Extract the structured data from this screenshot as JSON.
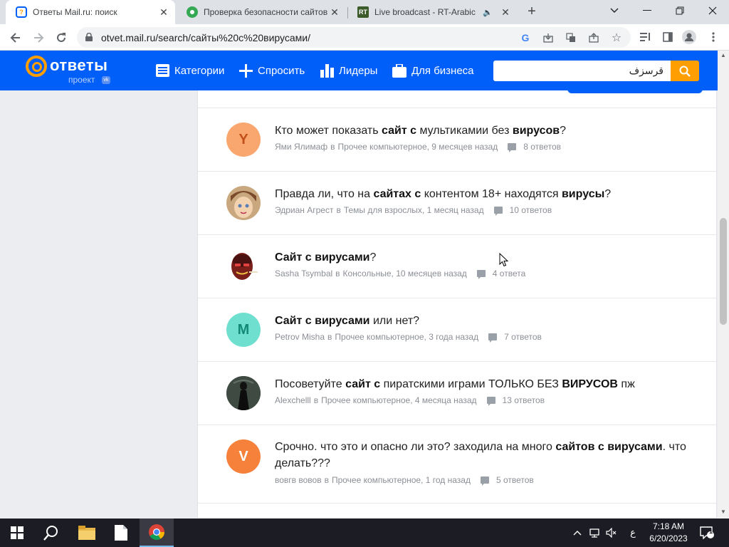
{
  "browser": {
    "tabs": [
      {
        "title": "Ответы Mail.ru: поиск",
        "favicon": "mail-answers-icon",
        "active": true
      },
      {
        "title": "Проверка безопасности сайтов",
        "favicon": "green-circle-icon",
        "active": false
      },
      {
        "title": "Live broadcast - RT-Arabic",
        "favicon": "rt-icon",
        "badge": "RT",
        "active": false
      }
    ],
    "new_tab_symbol": "+",
    "url": "otvet.mail.ru/search/сайты%20с%20вирусами/"
  },
  "site": {
    "logo_text": "ответы",
    "logo_sub": "проект",
    "logo_badge": "vk",
    "nav": [
      {
        "label": "Категории",
        "icon": "list-icon"
      },
      {
        "label": "Спросить",
        "icon": "plus-icon"
      },
      {
        "label": "Лидеры",
        "icon": "bar-chart-icon"
      },
      {
        "label": "Для бизнеса",
        "icon": "briefcase-icon"
      }
    ],
    "search_value": "قرسزف",
    "accent_color": "#005ff9",
    "button_color": "#ff9e00"
  },
  "results": [
    {
      "avatar_letter": "Y",
      "avatar_color": "#f9a66f",
      "avatar_text_color": "#c2501a",
      "question_parts": [
        {
          "t": "Кто может показать "
        },
        {
          "t": "сайт с",
          "b": true
        },
        {
          "t": " мультикамии без "
        },
        {
          "t": "вирусов",
          "b": true
        },
        {
          "t": "?"
        }
      ],
      "author": "Ями Ялимаф",
      "category": "Прочее компьютерное",
      "time": "9 месяцев назад",
      "answers": "8 ответов"
    },
    {
      "avatar_letter": "",
      "avatar_color": "#e8c9a8",
      "avatar_image": "cartoon-girl-avatar",
      "question_parts": [
        {
          "t": "Правда ли, что на "
        },
        {
          "t": "сайтах с",
          "b": true
        },
        {
          "t": " контентом 18+ находятся "
        },
        {
          "t": "вирусы",
          "b": true
        },
        {
          "t": "?"
        }
      ],
      "author": "Эдриан Агрест",
      "category": "Темы для взрослых",
      "time": "1 месяц назад",
      "answers": "10 ответов"
    },
    {
      "avatar_letter": "",
      "avatar_color": "#ffffff",
      "avatar_image": "red-face-avatar",
      "question_parts": [
        {
          "t": "Сайт с вирусами",
          "b": true
        },
        {
          "t": "?"
        }
      ],
      "author": "Sasha Tsymbal",
      "category": "Консольные",
      "time": "10 месяцев назад",
      "answers": "4 ответа"
    },
    {
      "avatar_letter": "M",
      "avatar_color": "#6fe0cf",
      "avatar_text_color": "#138a78",
      "question_parts": [
        {
          "t": "Сайт с вирусами",
          "b": true
        },
        {
          "t": " или нет?"
        }
      ],
      "author": "Petrov Misha",
      "category": "Прочее компьютерное",
      "time": "3 года назад",
      "answers": "7 ответов"
    },
    {
      "avatar_letter": "",
      "avatar_color": "#2d3a33",
      "avatar_image": "dark-figure-avatar",
      "question_parts": [
        {
          "t": "Посоветуйте "
        },
        {
          "t": "сайт с",
          "b": true
        },
        {
          "t": " пиратскими играми ТОЛЬКО БЕЗ "
        },
        {
          "t": "ВИРУСОВ",
          "b": true
        },
        {
          "t": " пж"
        }
      ],
      "author": "Alexchelll",
      "category": "Прочее компьютерное",
      "time": "4 месяца назад",
      "answers": "13 ответов"
    },
    {
      "avatar_letter": "V",
      "avatar_color": "#f5813b",
      "avatar_text_color": "#ffffff",
      "question_parts": [
        {
          "t": "Срочно. что это и опасно ли это? заходила на много "
        },
        {
          "t": "сайтов с",
          "b": true
        },
        {
          "t": " "
        },
        {
          "t": "вирусами",
          "b": true
        },
        {
          "t": ". что делать???"
        }
      ],
      "author": "вовгв вовов",
      "category": "Прочее компьютерное",
      "time": "1 год назад",
      "answers": "5 ответов"
    }
  ],
  "meta_connector": "в",
  "taskbar": {
    "time": "7:18 AM",
    "date": "6/20/2023",
    "lang": "ع",
    "notification_count": "1"
  }
}
